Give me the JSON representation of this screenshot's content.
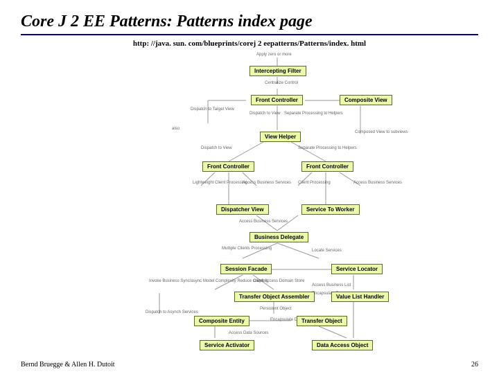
{
  "title": "Core J 2 EE Patterns: Patterns index page",
  "url": "http: //java. sun. com/blueprints/corej 2 eepatterns/Patterns/index. html",
  "footer": {
    "left": "Bernd Bruegge & Allen H. Dutoit",
    "right": "26"
  },
  "labels": {
    "apply": "Apply zero or more",
    "centralize": "Centralize Control",
    "dispatchTarget": "Dispatch to\nTarget View",
    "dispatchView": "Dispatch to\nView",
    "separateHelpers": "Separate Processing\nto Helpers",
    "dispatchView2": "Dispatch to\nView",
    "separateHelpers2": "Separate Processing\nto Helpers",
    "also": "also",
    "composed": "Composed View\nto subviews",
    "lightweight": "Lightweight\nClient\nProcessing",
    "accessBiz1": "Access\nBusiness\nServices",
    "clientProc": "Client\nProcessing",
    "accessBiz2": "Access\nBusiness\nServices",
    "accessBiz3": "Access\nBusiness\nServices",
    "multiple": "Multiple\nClients\nProcessing",
    "locate": "Locate\nServices",
    "invokeSync": "Invoke\nBusiness\nSync/async",
    "modelComplex": "Model\nComplexity\nReduce coupling",
    "clientAccess": "Client\nAccess\nDomain Store",
    "accessBizL": "Access Business\nList",
    "encapData": "Encapsulate Data",
    "persistent": "Persistent\nObject",
    "encapD2": "Encapsulate\nData",
    "accessDS": "Access Data\nSources",
    "dispatchAsync": "Dispatch to\nAsynch Services"
  },
  "nodes": {
    "interceptingFilter": "Intercepting Filter",
    "frontController1": "Front Controller",
    "compositeView": "Composite View",
    "viewHelper": "View Helper",
    "frontController2": "Front Controller",
    "frontController3": "Front Controller",
    "dispatcherView": "Dispatcher View",
    "serviceToWorker": "Service To Worker",
    "businessDelegate": "Business Delegate",
    "sessionFacade": "Session Facade",
    "serviceLocator": "Service Locator",
    "transferObjAssembler": "Transfer Object Assembler",
    "valueListHandler": "Value List Handler",
    "compositeEntity": "Composite Entity",
    "transferObject": "Transfer Object",
    "serviceActivator": "Service Activator",
    "dataAccessObject": "Data Access Object"
  }
}
